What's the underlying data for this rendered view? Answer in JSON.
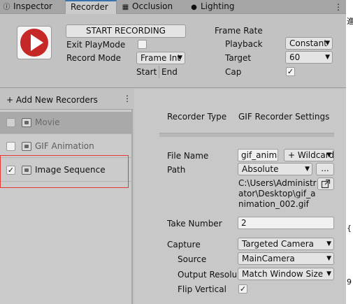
{
  "tabs": [
    {
      "icon": "info-icon",
      "glyph": "ⓘ",
      "label": "Inspector"
    },
    {
      "icon": "",
      "glyph": "",
      "label": "Recorder"
    },
    {
      "icon": "occlusion-icon",
      "glyph": "▦",
      "label": "Occlusion"
    },
    {
      "icon": "lighting-icon",
      "glyph": "●",
      "label": "Lighting"
    }
  ],
  "edge_glyphs": [
    "進",
    "{",
    "9"
  ],
  "top": {
    "start_recording": "START RECORDING",
    "exit_playmode_label": "Exit PlayMode",
    "record_mode_label": "Record Mode",
    "record_mode_value": "Frame Int",
    "start_label": "Start",
    "end_label": "End",
    "frame_rate_label": "Frame Rate",
    "playback_label": "Playback",
    "playback_value": "Constant",
    "target_label": "Target",
    "target_value": "60",
    "cap_label": "Cap",
    "cap_checked": "✓"
  },
  "left": {
    "add_new": "+ Add New Recorders",
    "menu_glyph": "⋮",
    "recorders": [
      {
        "label": "Movie",
        "checked": ""
      },
      {
        "label": "GIF Animation",
        "checked": ""
      },
      {
        "label": "Image Sequence",
        "checked": "✓"
      }
    ]
  },
  "right": {
    "recorder_type_label": "Recorder Type",
    "recorder_type_value": "GIF Recorder Settings",
    "file_name_label": "File Name",
    "file_name_value": "gif_anima",
    "wildcards": "+ Wildcard",
    "path_label": "Path",
    "path_value": "Absolute",
    "browse": "...",
    "path_text": [
      "C:\\Users\\Administr",
      "ator\\Desktop\\gif_a",
      "nimation_002.gif"
    ],
    "take_number_label": "Take Number",
    "take_number_value": "2",
    "capture_label": "Capture",
    "capture_value": "Targeted Camera",
    "source_label": "Source",
    "source_value": "MainCamera",
    "output_res_label": "Output Resolut",
    "output_res_value": "Match Window Size",
    "flip_label": "Flip Vertical",
    "flip_checked": "✓"
  },
  "colors": {
    "accent": "#3a72b0",
    "record_red": "#c62828",
    "selection_outline": "#e53935"
  }
}
